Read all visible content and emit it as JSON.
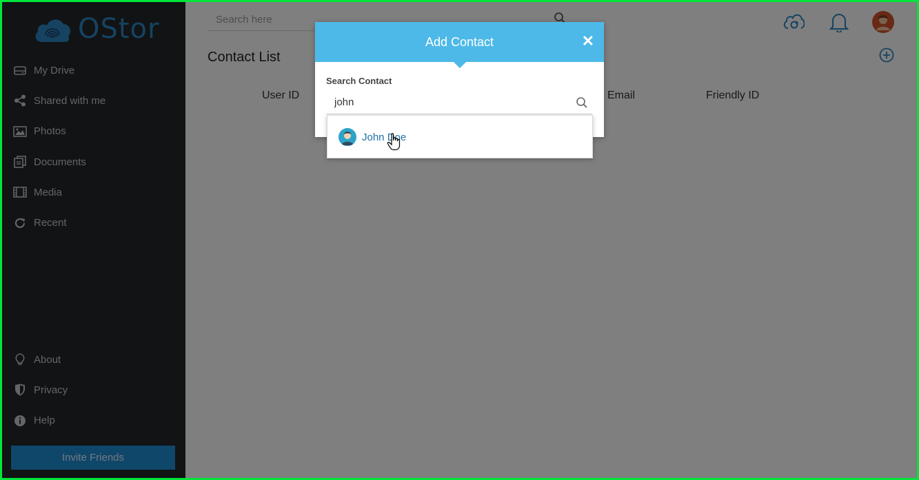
{
  "app": {
    "logo_text": "OStor"
  },
  "sidebar": {
    "items": [
      {
        "label": "My Drive",
        "icon": "drive-icon"
      },
      {
        "label": "Shared with me",
        "icon": "share-icon"
      },
      {
        "label": "Photos",
        "icon": "photo-icon"
      },
      {
        "label": "Documents",
        "icon": "documents-icon"
      },
      {
        "label": "Media",
        "icon": "film-icon"
      },
      {
        "label": "Recent",
        "icon": "refresh-icon"
      }
    ],
    "bottom_items": [
      {
        "label": "About",
        "icon": "lightbulb-icon"
      },
      {
        "label": "Privacy",
        "icon": "shield-icon"
      },
      {
        "label": "Help",
        "icon": "info-icon"
      }
    ],
    "invite_label": "Invite Friends"
  },
  "header": {
    "search_placeholder": "Search here",
    "icons": [
      "cloud-sync-icon",
      "bell-icon",
      "avatar"
    ]
  },
  "main": {
    "title": "Contact List",
    "columns": [
      "User ID",
      "Email",
      "Friendly ID"
    ]
  },
  "modal": {
    "title": "Add Contact",
    "search_label": "Search Contact",
    "search_value": "john",
    "results": [
      {
        "name": "John Doe"
      }
    ]
  },
  "colors": {
    "accent": "#4db9e8",
    "sidebar_bg": "#252628",
    "brand_blue": "#2a86c2",
    "invite_button": "#1f8fd6"
  }
}
